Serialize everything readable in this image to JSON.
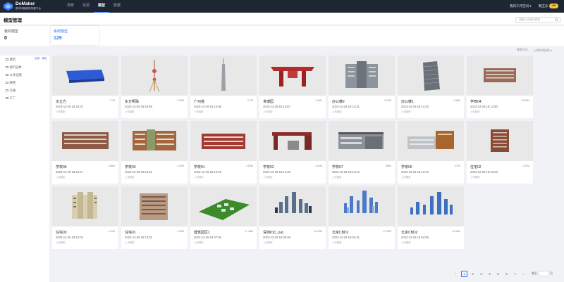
{
  "app": {
    "name": "DoMaker",
    "subtitle": "数字场景高效构建平台"
  },
  "nav": [
    {
      "label": "场景"
    },
    {
      "label": "资源"
    },
    {
      "label": "模型"
    },
    {
      "label": "数据"
    }
  ],
  "header": {
    "workspace": "我的工作空间 ▾",
    "user": "魏玉东",
    "badge": "VIP",
    "page_title": "模型管理",
    "search_placeholder": "请输入关键词搜索"
  },
  "stats": [
    {
      "label": "我的模型",
      "value": "0"
    },
    {
      "label": "系统模型",
      "value": "129"
    }
  ],
  "toolbar": {
    "sort_label": "排序方式:",
    "sort_value": "上传时间排序 ▾"
  },
  "sidebar": {
    "select_all": "全部",
    "clear": "清空",
    "categories": [
      "建筑",
      "城市园林",
      "公共设施",
      "植物",
      "交通",
      "工厂"
    ]
  },
  "models": [
    {
      "name": "水立方",
      "size": "7.7M",
      "date": "2023-12-29 18:16:01",
      "type": "上传模型"
    },
    {
      "name": "东方明珠",
      "size": "3.06M",
      "date": "2023-12-29 18:15:59",
      "type": "上传模型"
    },
    {
      "name": "广州塔",
      "size": "2.7M",
      "date": "2023-12-29 18:15:58",
      "type": "上传模型"
    },
    {
      "name": "世博园",
      "size": "1.48M",
      "date": "2023-12-29 18:15:57",
      "type": "上传模型"
    },
    {
      "name": "办公楼2",
      "size": "3.97M",
      "date": "2023-12-29 18:14:31",
      "type": "上传模型"
    },
    {
      "name": "办公楼1",
      "size": "1.88M",
      "date": "2023-12-29 18:14:30",
      "type": "上传模型"
    },
    {
      "name": "学校04",
      "size": "14.88M",
      "date": "2023-12-29 18:13:50",
      "type": "上传模型"
    },
    {
      "name": "学校06",
      "size": "3.68M",
      "date": "2023-12-29 18:13:47",
      "type": "上传模型"
    },
    {
      "name": "学校03",
      "size": "3.24M",
      "date": "2023-12-29 18:13:46",
      "type": "上传模型"
    },
    {
      "name": "学校01",
      "size": "2.05M",
      "date": "2023-12-29 18:13:45",
      "type": "上传模型"
    },
    {
      "name": "学校02",
      "size": "1.81M",
      "date": "2023-12-29 18:13:45",
      "type": "上传模型"
    },
    {
      "name": "学校07",
      "size": "388K",
      "date": "2023-12-29 18:13:44",
      "type": "上传模型"
    },
    {
      "name": "学校05",
      "size": "372K",
      "date": "2023-12-29 18:13:44",
      "type": "上传模型"
    },
    {
      "name": "住宅02",
      "size": "1.57M",
      "date": "2023-12-29 18:13:03",
      "type": "上传模型"
    },
    {
      "name": "住宅03",
      "size": "1.41M",
      "date": "2023-12-29 18:13:03",
      "type": "上传模型"
    },
    {
      "name": "住宅01",
      "size": "1.39M",
      "date": "2023-12-29 18:13:02",
      "type": "上传模型"
    },
    {
      "name": "建筑园区1",
      "size": "17.48M",
      "date": "2023-12-29 18:07:39",
      "type": "上传模型"
    },
    {
      "name": "深圳IOC_out",
      "size": "34.02M",
      "date": "2023-12-29 18:05:26",
      "type": "上传模型"
    },
    {
      "name": "北京CBD1",
      "size": "17.28M",
      "date": "2023-12-29 18:04:41",
      "type": "上传模型"
    },
    {
      "name": "北京CBD2",
      "size": "13.33M",
      "date": "2023-12-29 18:04:09",
      "type": "上传模型"
    }
  ],
  "pagination": {
    "prev": "‹",
    "pages": [
      "1",
      "2",
      "3",
      "4",
      "5",
      "6",
      "7"
    ],
    "next": "›",
    "goto_label": "跳至",
    "goto_suffix": "页"
  },
  "colors": {
    "topbar": "#1f2633",
    "accent": "#2b7cff",
    "badge": "#f4c542"
  }
}
